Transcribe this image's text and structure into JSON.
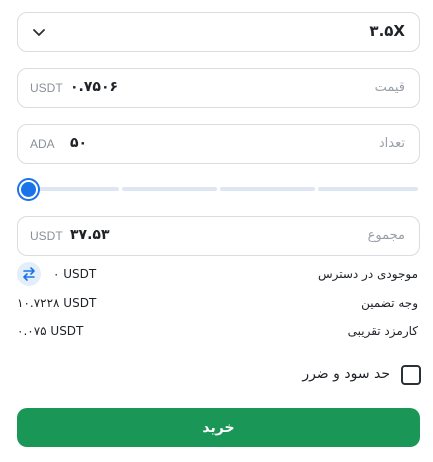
{
  "leverage": {
    "value": "۳.۵X",
    "chevron_icon": "chevron-down-icon"
  },
  "price": {
    "label": "قیمت",
    "value": "۰.۷۵۰۶",
    "unit": "USDT"
  },
  "quantity": {
    "label": "تعداد",
    "value": "۵۰",
    "unit": "ADA"
  },
  "slider": {
    "level_percent": 0,
    "segments": 4
  },
  "total": {
    "label": "مجموع",
    "value": "۳۷.۵۳",
    "unit": "USDT"
  },
  "available": {
    "label": "موجودی در دسترس",
    "value": "۰ USDT",
    "icon": "swap-icon"
  },
  "margin": {
    "label": "وجه تضمین",
    "value": "۱۰.۷۲۲۸ USDT"
  },
  "fee": {
    "label": "کارمزد تقریبی",
    "value": "۰.۰۷۵ USDT"
  },
  "tpsl": {
    "label": "حد سود و ضرر",
    "checked": false
  },
  "buy_button": {
    "label": "خرید"
  },
  "colors": {
    "accent": "#1a73e8",
    "buy": "#1a9657",
    "border": "#d9dce1"
  }
}
